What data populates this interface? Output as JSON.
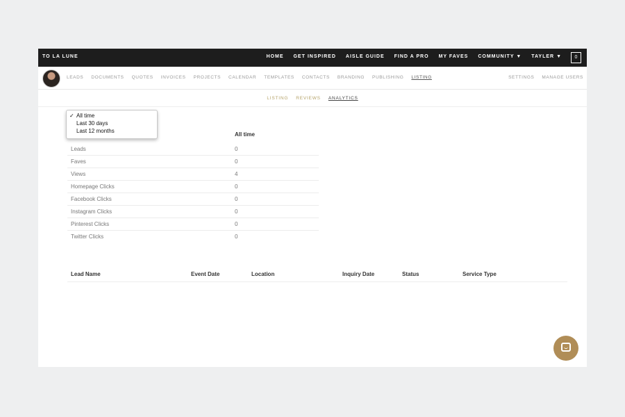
{
  "topbar": {
    "brand": "TO LA LUNE",
    "nav": [
      "HOME",
      "GET INSPIRED",
      "AISLE GUIDE",
      "FIND A PRO",
      "MY FAVES"
    ],
    "community": "COMMUNITY",
    "user": "TAYLER",
    "cart_count": "0"
  },
  "subnav": {
    "links": [
      "LEADS",
      "DOCUMENTS",
      "QUOTES",
      "INVOICES",
      "PROJECTS",
      "CALENDAR",
      "TEMPLATES",
      "CONTACTS",
      "BRANDING",
      "PUBLISHING",
      "LISTING"
    ],
    "active": "LISTING",
    "right": [
      "SETTINGS",
      "MANAGE USERS"
    ]
  },
  "tabs": [
    "LISTING",
    "REVIEWS",
    "ANALYTICS"
  ],
  "active_tab": "ANALYTICS",
  "period_select": {
    "options": [
      "All time",
      "Last 30 days",
      "Last 12 months"
    ],
    "selected": "All time",
    "check": "✓"
  },
  "stats": {
    "column_header": "All time",
    "rows": [
      {
        "label": "Leads",
        "value": "0"
      },
      {
        "label": "Faves",
        "value": "0"
      },
      {
        "label": "Views",
        "value": "4"
      },
      {
        "label": "Homepage Clicks",
        "value": "0"
      },
      {
        "label": "Facebook Clicks",
        "value": "0"
      },
      {
        "label": "Instagram Clicks",
        "value": "0"
      },
      {
        "label": "Pinterest Clicks",
        "value": "0"
      },
      {
        "label": "Twitter Clicks",
        "value": "0"
      }
    ]
  },
  "leads_table": {
    "columns": [
      "Lead Name",
      "Event Date",
      "Location",
      "Inquiry Date",
      "Status",
      "Service Type"
    ]
  },
  "colors": {
    "topbar": "#1d1d1d",
    "accent_gold": "#b5a36a",
    "chat_button": "#b08d57"
  },
  "icons": {
    "chat": "chat-icon",
    "cart": "cart-icon"
  }
}
